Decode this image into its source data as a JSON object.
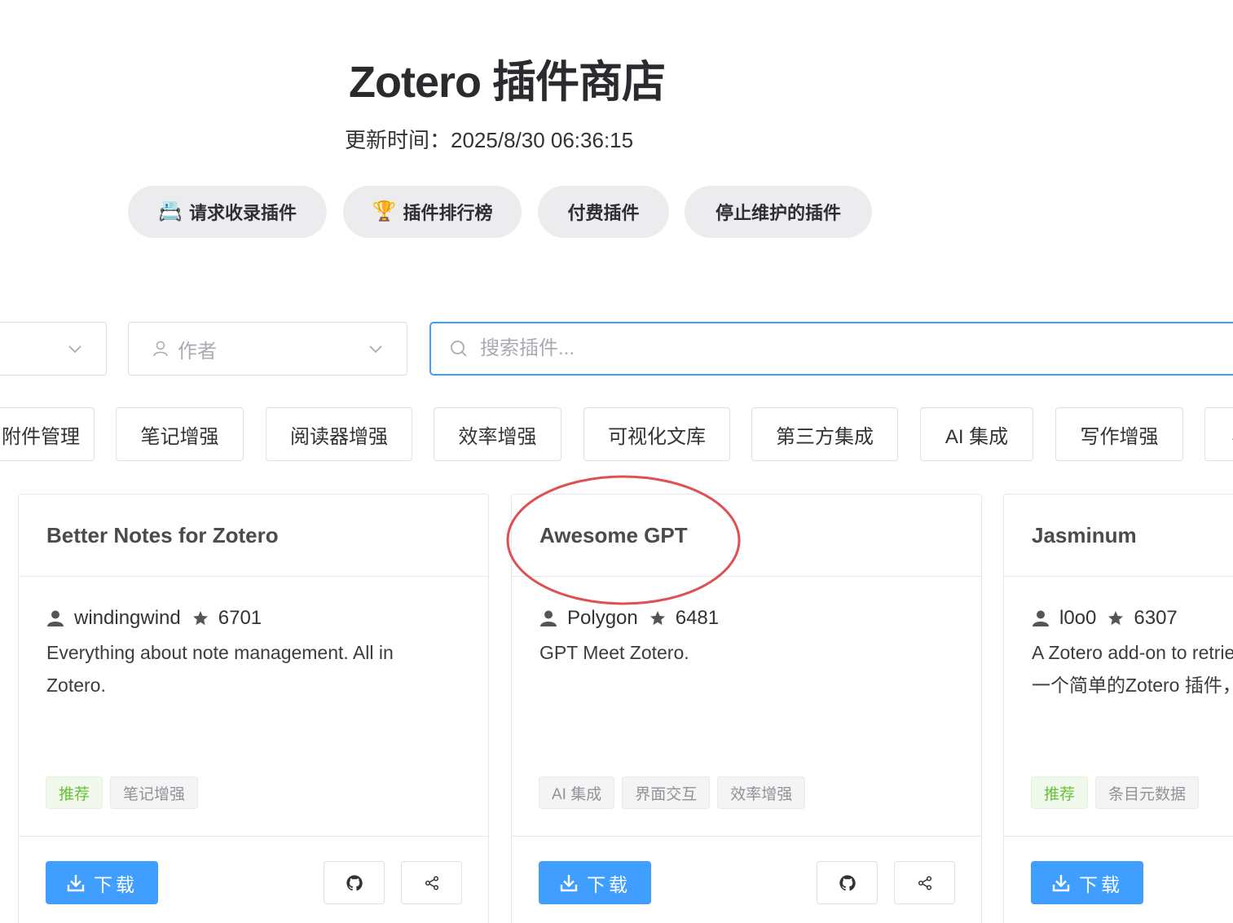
{
  "header": {
    "title": "Zotero 插件商店",
    "updated": "更新时间：2025/8/30 06:36:15"
  },
  "nav": {
    "request": {
      "emoji": "📇",
      "label": "请求收录插件"
    },
    "ranking": {
      "emoji": "🏆",
      "label": "插件排行榜"
    },
    "paid": {
      "label": "付费插件"
    },
    "unmaintained": {
      "label": "停止维护的插件"
    }
  },
  "filters": {
    "author_placeholder": "作者",
    "search_placeholder": "搜索插件..."
  },
  "categories": [
    "附件管理",
    "笔记增强",
    "阅读器增强",
    "效率增强",
    "可视化文库",
    "第三方集成",
    "AI 集成",
    "写作增强",
    "界"
  ],
  "cards": [
    {
      "title": "Better Notes for Zotero",
      "author": "windingwind",
      "stars": "6701",
      "description": "Everything about note management. All in Zotero.",
      "description_line2": "",
      "tags": [
        {
          "label": "推荐",
          "style": "green"
        },
        {
          "label": "笔记增强",
          "style": "gray"
        }
      ],
      "download_label": "下载"
    },
    {
      "title": "Awesome GPT",
      "author": "Polygon",
      "stars": "6481",
      "description": "GPT Meet Zotero.",
      "description_line2": "",
      "tags": [
        {
          "label": "AI 集成",
          "style": "gray"
        },
        {
          "label": "界面交互",
          "style": "gray"
        },
        {
          "label": "效率增强",
          "style": "gray"
        }
      ],
      "download_label": "下载"
    },
    {
      "title": "Jasminum",
      "author": "l0o0",
      "stars": "6307",
      "description": "A Zotero add-on to retrieve CNKI metadata.",
      "description_line2": "一个简单的Zotero 插件，用于识别中文元数据",
      "tags": [
        {
          "label": "推荐",
          "style": "green"
        },
        {
          "label": "条目元数据",
          "style": "gray"
        }
      ],
      "download_label": "下载"
    }
  ],
  "colors": {
    "primary": "#409eff",
    "annotation": "#e05050",
    "tag_green_text": "#67c23a"
  }
}
